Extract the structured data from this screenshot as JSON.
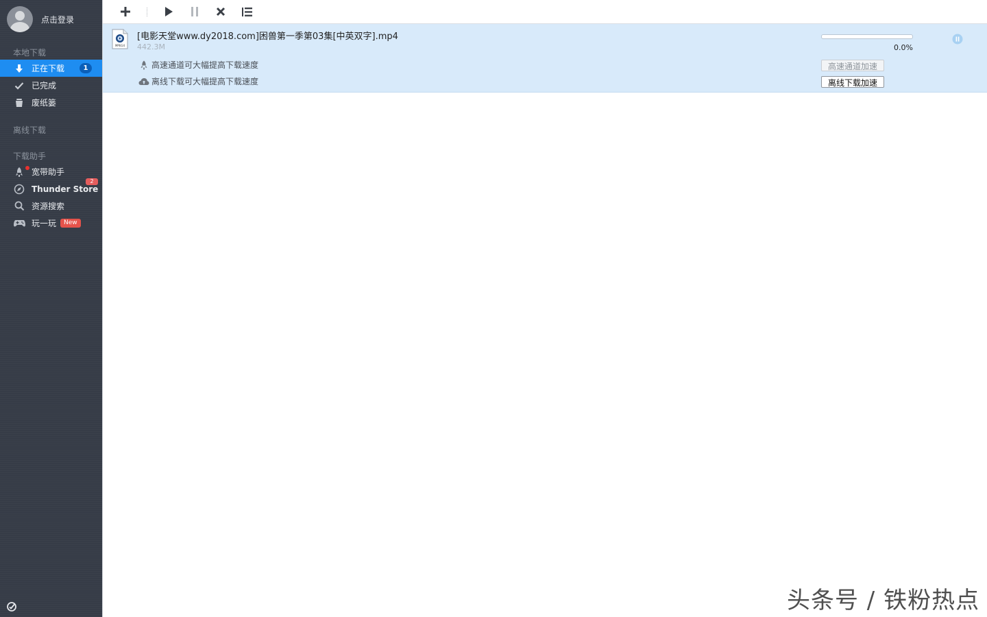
{
  "sidebar": {
    "login_label": "点击登录",
    "local_section": "本地下载",
    "offline_section": "离线下载",
    "helper_section": "下载助手",
    "items": [
      {
        "label": "正在下载",
        "badge": "1"
      },
      {
        "label": "已完成"
      },
      {
        "label": "废纸篓"
      },
      {
        "label": "宽带助手"
      },
      {
        "label": "Thunder Store",
        "badge": "2"
      },
      {
        "label": "资源搜索"
      },
      {
        "label": "玩一玩",
        "badge": "New"
      }
    ]
  },
  "task": {
    "name": "[电影天堂www.dy2018.com]困兽第一季第03集[中英双字].mp4",
    "size": "442.3M",
    "hint_highspeed": "高速通道可大幅提高下载速度",
    "hint_offline": "离线下载可大幅提高下载速度",
    "progress_percent": "0.0%",
    "progress_value": 0.0,
    "btn_highspeed": "高速通道加速",
    "btn_offline": "离线下载加速",
    "file_icon_label": "MPEG4"
  },
  "colors": {
    "sidebar_bg": "#363c47",
    "accent": "#1e8df1",
    "task_row_bg": "#d8eafa",
    "badge_red": "#e5534b"
  },
  "watermark": "头条号 / 铁粉热点"
}
